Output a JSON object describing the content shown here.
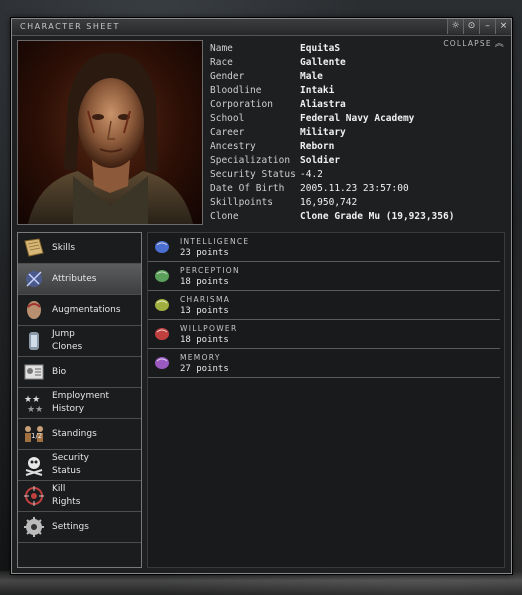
{
  "window": {
    "title": "CHARACTER SHEET",
    "buttons": [
      "settings-icon",
      "minimize-circle-icon",
      "minimize-icon",
      "close-icon"
    ],
    "collapse_label": "COLLAPSE"
  },
  "info": [
    {
      "label": "Name",
      "value": "EquitaS"
    },
    {
      "label": "Race",
      "value": "Gallente"
    },
    {
      "label": "Gender",
      "value": "Male"
    },
    {
      "label": "Bloodline",
      "value": "Intaki"
    },
    {
      "label": "Corporation",
      "value": "Aliastra"
    },
    {
      "label": "School",
      "value": "Federal Navy Academy"
    },
    {
      "label": "Career",
      "value": "Military"
    },
    {
      "label": "Ancestry",
      "value": "Reborn"
    },
    {
      "label": "Specialization",
      "value": "Soldier"
    },
    {
      "label": "Security Status",
      "value": "-4.2"
    },
    {
      "label": "Date Of Birth",
      "value": "2005.11.23 23:57:00"
    },
    {
      "label": "Skillpoints",
      "value": "16,950,742"
    },
    {
      "label": "Clone",
      "value": "Clone Grade Mu (19,923,356)"
    }
  ],
  "sidebar": {
    "items": [
      {
        "line1": "Skills",
        "line2": "",
        "icon": "skills-book-icon",
        "active": false
      },
      {
        "line1": "Attributes",
        "line2": "",
        "icon": "attributes-icon",
        "active": true
      },
      {
        "line1": "Augmentations",
        "line2": "",
        "icon": "augmentations-icon",
        "active": false
      },
      {
        "line1": "Jump",
        "line2": "Clones",
        "icon": "jump-clones-icon",
        "active": false
      },
      {
        "line1": "Bio",
        "line2": "",
        "icon": "bio-icon",
        "active": false
      },
      {
        "line1": "Employment",
        "line2": "History",
        "icon": "employment-history-icon",
        "active": false
      },
      {
        "line1": "Standings",
        "line2": "",
        "icon": "standings-icon",
        "active": false
      },
      {
        "line1": "Security",
        "line2": "Status",
        "icon": "security-status-icon",
        "active": false
      },
      {
        "line1": "Kill",
        "line2": "Rights",
        "icon": "kill-rights-icon",
        "active": false
      },
      {
        "line1": "Settings",
        "line2": "",
        "icon": "settings-icon",
        "active": false
      }
    ]
  },
  "attributes": [
    {
      "name": "INTELLIGENCE",
      "value": "23 points",
      "color": "#4a6fd0"
    },
    {
      "name": "PERCEPTION",
      "value": "18 points",
      "color": "#5aa05a"
    },
    {
      "name": "CHARISMA",
      "value": "13 points",
      "color": "#a0b040"
    },
    {
      "name": "WILLPOWER",
      "value": "18 points",
      "color": "#c04040"
    },
    {
      "name": "MEMORY",
      "value": "27 points",
      "color": "#9a5ac0"
    }
  ]
}
